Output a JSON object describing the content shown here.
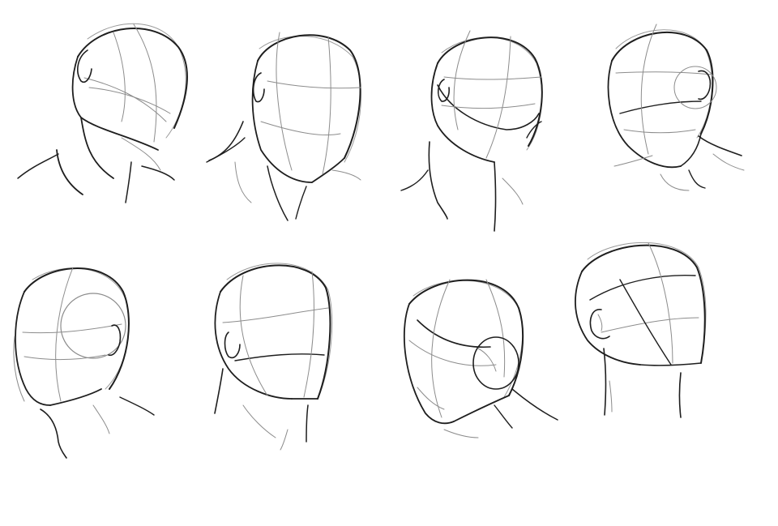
{
  "sketch_sheet": {
    "subject": "head-construction-studies",
    "rows": [
      {
        "heads": [
          {
            "id": "head-1",
            "view": "three-quarter-down-right"
          },
          {
            "id": "head-2",
            "view": "three-quarter-up-right"
          },
          {
            "id": "head-3",
            "view": "looking-up-right"
          },
          {
            "id": "head-4",
            "view": "three-quarter-down-left"
          }
        ]
      },
      {
        "heads": [
          {
            "id": "head-5",
            "view": "three-quarter-left"
          },
          {
            "id": "head-6",
            "view": "three-quarter-down-right-ear"
          },
          {
            "id": "head-7",
            "view": "tilted-down-left"
          },
          {
            "id": "head-8",
            "view": "back-three-quarter"
          }
        ]
      }
    ],
    "colors": {
      "background": "#ffffff",
      "ink_dark": "#1e1e1e",
      "ink_light": "#8c8c8c"
    }
  }
}
